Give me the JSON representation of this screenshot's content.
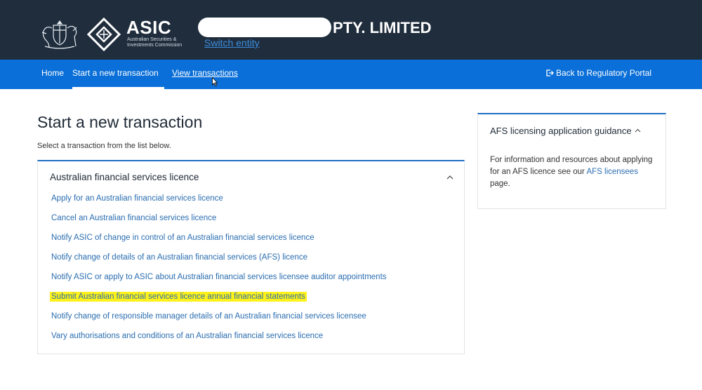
{
  "header": {
    "logo_text": "ASIC",
    "logo_subtitle": "Australian Securities & Investments Commission",
    "entity_name_suffix": "PTY. LIMITED",
    "switch_entity_label": "Switch entity"
  },
  "nav": {
    "home": "Home",
    "start": "Start a new transaction",
    "view": "View transactions",
    "back": "Back to Regulatory Portal"
  },
  "main": {
    "title": "Start a new transaction",
    "subtitle": "Select a transaction from the list below."
  },
  "panel": {
    "title": "Australian financial services licence",
    "items": [
      "Apply for an Australian financial services licence",
      "Cancel an Australian financial services licence",
      "Notify ASIC of change in control of an Australian financial services licence",
      "Notify change of details of an Australian financial services (AFS) licence",
      "Notify ASIC or apply to ASIC about Australian financial services licensee auditor appointments",
      "Submit Australian financial services licence annual financial statements",
      "Notify change of responsible manager details of an Australian financial services licensee",
      "Vary authorisations and conditions of an Australian financial services licence"
    ]
  },
  "guidance": {
    "title": "AFS licensing application guidance",
    "body_prefix": "For information and resources about applying for an AFS licence see our",
    "link": "AFS licensees",
    "body_suffix": "page."
  },
  "colors": {
    "header_bg": "#1f2d3d",
    "nav_bg": "#0a6fd8",
    "link": "#2a6db0",
    "highlight": "#fff21a"
  },
  "icons": {
    "crest": "coat-of-arms-icon",
    "logo": "asic-diamond-icon",
    "back": "exit-icon",
    "collapse": "chevron-up-icon",
    "cursor": "mouse-pointer-icon"
  }
}
